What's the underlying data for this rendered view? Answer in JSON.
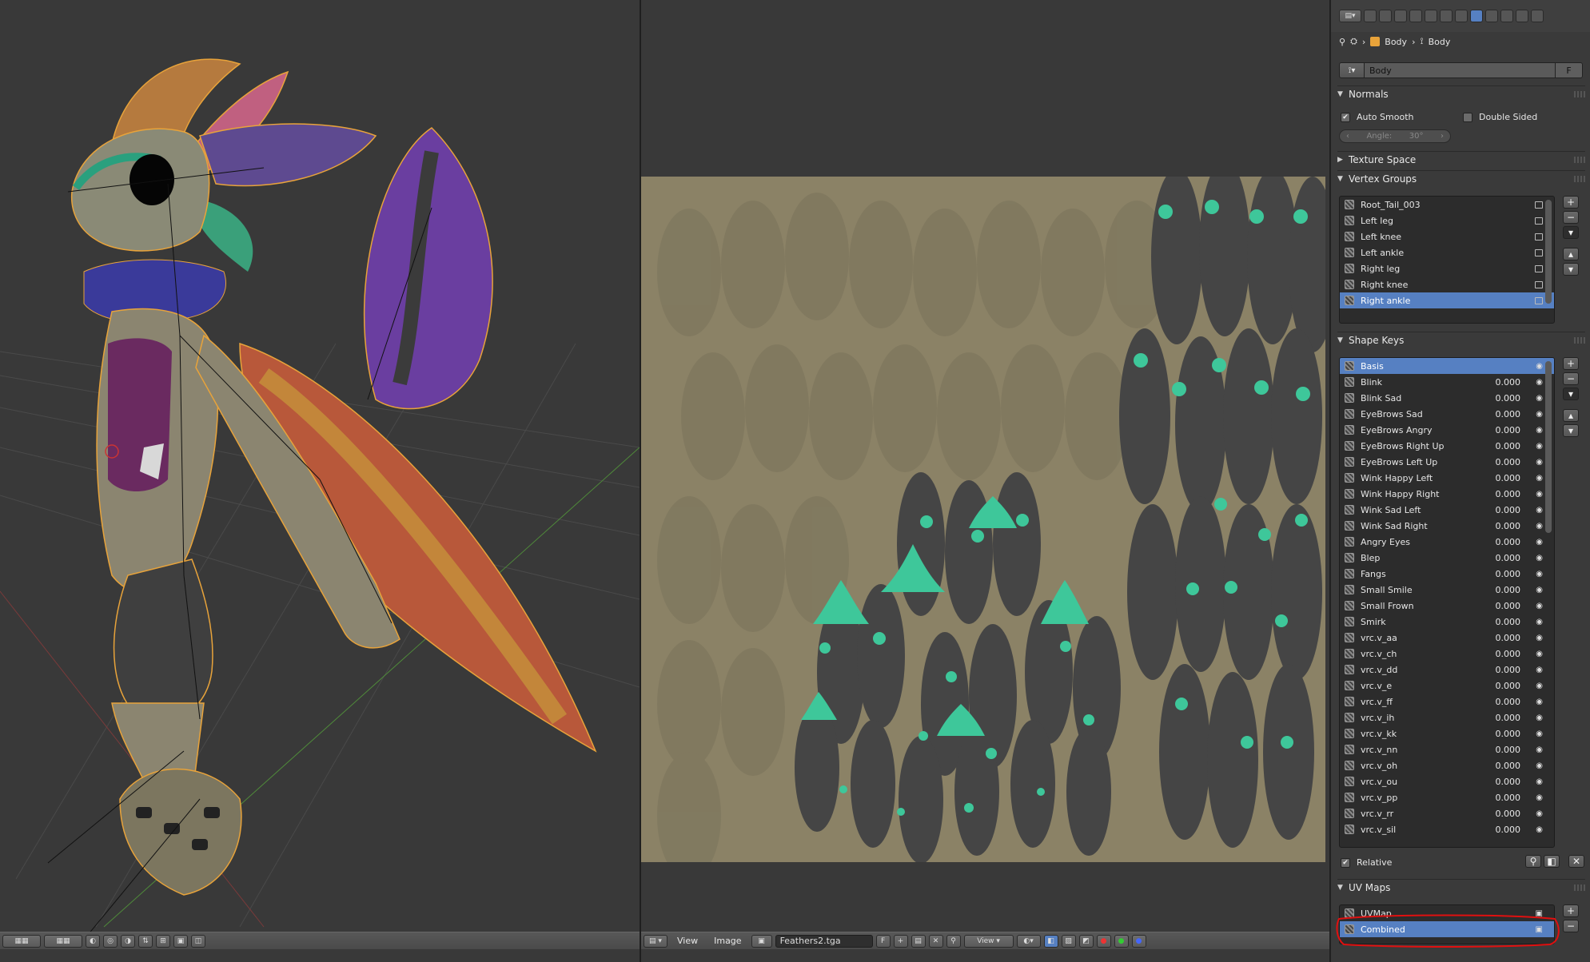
{
  "viewport3d": {
    "header_buttons": [
      "mode-grid",
      "layers-grid",
      "shading",
      "pivot",
      "manipulator",
      "snap",
      "render",
      "camera"
    ]
  },
  "image_editor": {
    "menus": [
      "View",
      "Image"
    ],
    "image_name": "Feathers2.tga",
    "fake_user": "F",
    "view_label": "View"
  },
  "properties": {
    "breadcrumb": [
      "Body",
      "Body"
    ],
    "mesh_name": "Body",
    "mesh_fake_user": "F",
    "normals": {
      "title": "Normals",
      "auto_smooth": "Auto Smooth",
      "auto_smooth_checked": true,
      "double_sided": "Double Sided",
      "double_sided_checked": false,
      "angle_label": "Angle:",
      "angle_value": "30°"
    },
    "texture_space": {
      "title": "Texture Space"
    },
    "vertex_groups": {
      "title": "Vertex Groups",
      "items": [
        "Root_Tail_003",
        "Left leg",
        "Left knee",
        "Left ankle",
        "Right leg",
        "Right knee",
        "Right ankle"
      ],
      "selected": "Right ankle"
    },
    "shape_keys": {
      "title": "Shape Keys",
      "items": [
        {
          "name": "Basis",
          "value": ""
        },
        {
          "name": "Blink",
          "value": "0.000"
        },
        {
          "name": "Blink Sad",
          "value": "0.000"
        },
        {
          "name": "EyeBrows Sad",
          "value": "0.000"
        },
        {
          "name": "EyeBrows Angry",
          "value": "0.000"
        },
        {
          "name": "EyeBrows Right Up",
          "value": "0.000"
        },
        {
          "name": "EyeBrows Left Up",
          "value": "0.000"
        },
        {
          "name": "Wink Happy Left",
          "value": "0.000"
        },
        {
          "name": "Wink Happy Right",
          "value": "0.000"
        },
        {
          "name": "Wink Sad Left",
          "value": "0.000"
        },
        {
          "name": "Wink Sad Right",
          "value": "0.000"
        },
        {
          "name": "Angry Eyes",
          "value": "0.000"
        },
        {
          "name": "Blep",
          "value": "0.000"
        },
        {
          "name": "Fangs",
          "value": "0.000"
        },
        {
          "name": "Small Smile",
          "value": "0.000"
        },
        {
          "name": "Small Frown",
          "value": "0.000"
        },
        {
          "name": "Smirk",
          "value": "0.000"
        },
        {
          "name": "vrc.v_aa",
          "value": "0.000"
        },
        {
          "name": "vrc.v_ch",
          "value": "0.000"
        },
        {
          "name": "vrc.v_dd",
          "value": "0.000"
        },
        {
          "name": "vrc.v_e",
          "value": "0.000"
        },
        {
          "name": "vrc.v_ff",
          "value": "0.000"
        },
        {
          "name": "vrc.v_ih",
          "value": "0.000"
        },
        {
          "name": "vrc.v_kk",
          "value": "0.000"
        },
        {
          "name": "vrc.v_nn",
          "value": "0.000"
        },
        {
          "name": "vrc.v_oh",
          "value": "0.000"
        },
        {
          "name": "vrc.v_ou",
          "value": "0.000"
        },
        {
          "name": "vrc.v_pp",
          "value": "0.000"
        },
        {
          "name": "vrc.v_rr",
          "value": "0.000"
        },
        {
          "name": "vrc.v_sil",
          "value": "0.000"
        }
      ],
      "selected": "Basis",
      "relative": "Relative",
      "relative_checked": true
    },
    "uv_maps": {
      "title": "UV Maps",
      "items": [
        "UVMap",
        "Combined"
      ],
      "selected": "Combined"
    }
  },
  "colors": {
    "selection": "#5680c2",
    "annotation": "#e01010",
    "object_outline": "#e8a33a"
  }
}
